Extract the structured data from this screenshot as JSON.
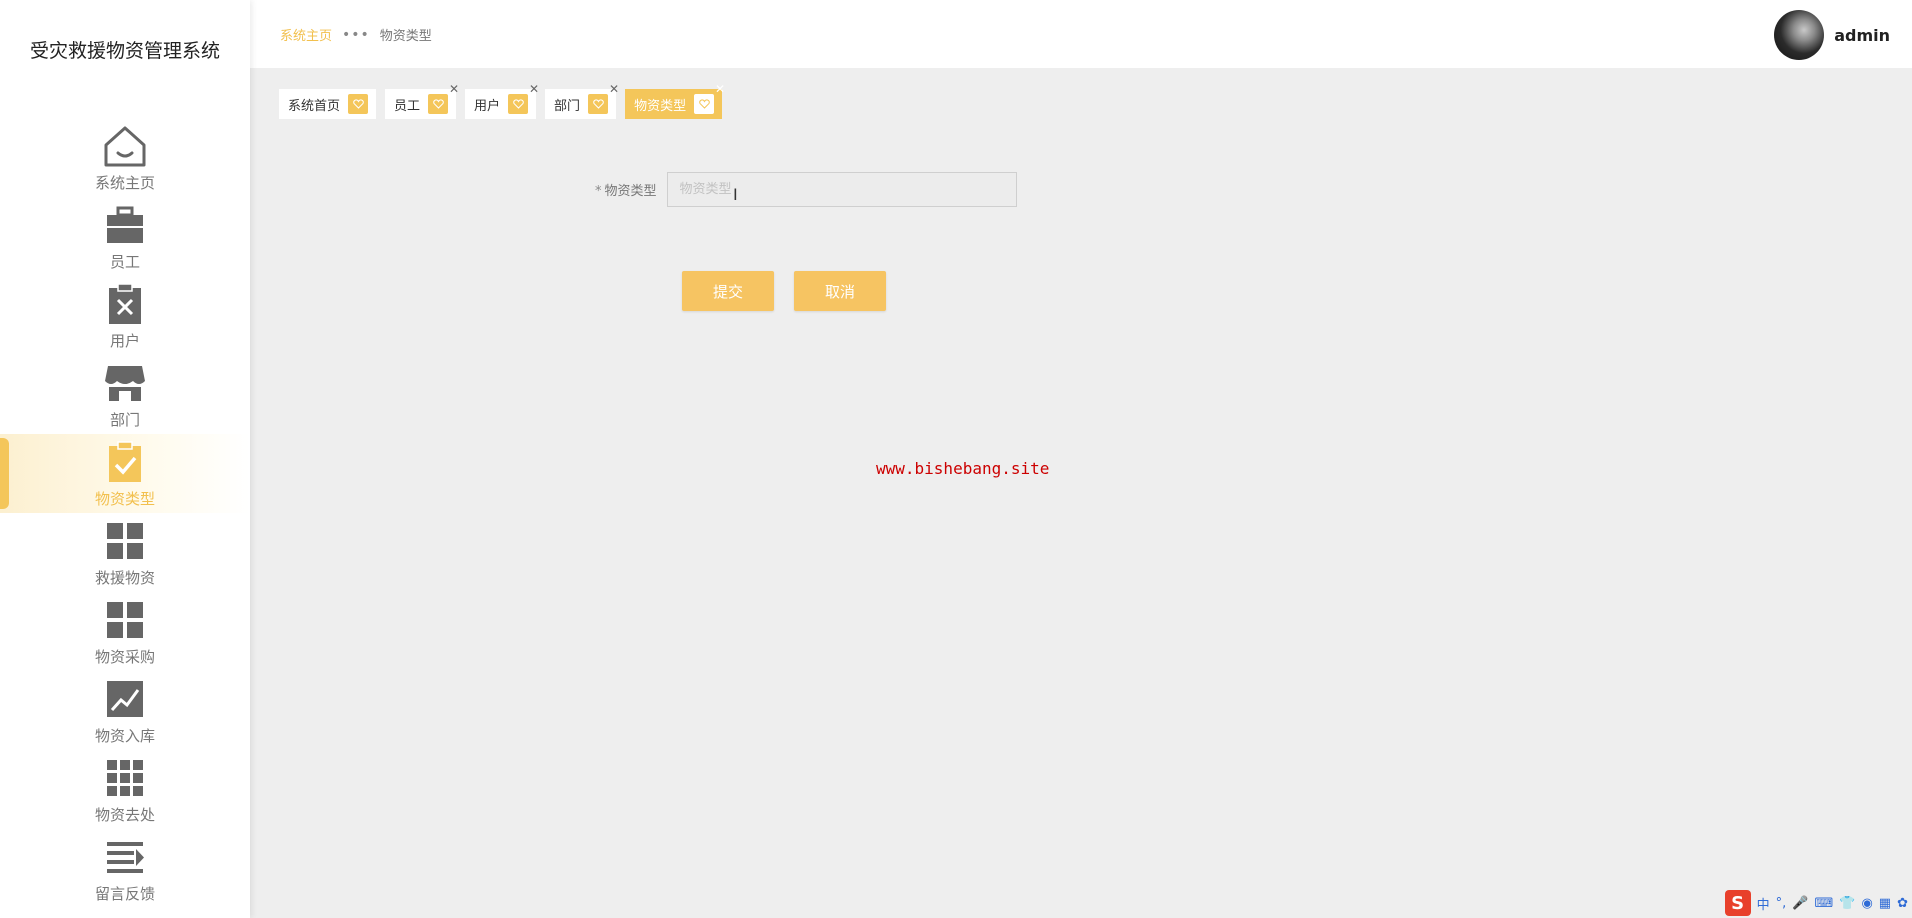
{
  "app": {
    "title": "受灾救援物资管理系统"
  },
  "sidebar": {
    "items": [
      {
        "label": "系统主页",
        "icon": "home-icon",
        "active": false
      },
      {
        "label": "员工",
        "icon": "briefcase-icon",
        "active": false
      },
      {
        "label": "用户",
        "icon": "clipboard-x-icon",
        "active": false
      },
      {
        "label": "部门",
        "icon": "storefront-icon",
        "active": false
      },
      {
        "label": "物资类型",
        "icon": "clipboard-check-icon",
        "active": true
      },
      {
        "label": "救援物资",
        "icon": "grid-icon",
        "active": false
      },
      {
        "label": "物资采购",
        "icon": "grid-icon",
        "active": false
      },
      {
        "label": "物资入库",
        "icon": "trend-chart-icon",
        "active": false
      },
      {
        "label": "物资去处",
        "icon": "grid-9-icon",
        "active": false
      },
      {
        "label": "留言反馈",
        "icon": "list-arrow-icon",
        "active": false
      }
    ]
  },
  "header": {
    "breadcrumb": {
      "home": "系统主页",
      "separator": "•••",
      "current": "物资类型"
    },
    "user": {
      "name": "admin"
    }
  },
  "tabs": [
    {
      "label": "系统首页",
      "closable": false,
      "active": false
    },
    {
      "label": "员工",
      "closable": true,
      "active": false
    },
    {
      "label": "用户",
      "closable": true,
      "active": false
    },
    {
      "label": "部门",
      "closable": true,
      "active": false
    },
    {
      "label": "物资类型",
      "closable": true,
      "active": true
    }
  ],
  "form": {
    "required_mark": "*",
    "field_label": "物资类型",
    "field_placeholder": "物资类型",
    "field_value": "",
    "submit_label": "提交",
    "cancel_label": "取消"
  },
  "watermark": "www.bishebang.site",
  "tray": {
    "ime_logo": "S",
    "ime_mode": "中",
    "punct": "°,"
  },
  "colors": {
    "accent": "#f4c65a",
    "accent_text": "#f2c04e",
    "watermark": "#cc0000"
  }
}
